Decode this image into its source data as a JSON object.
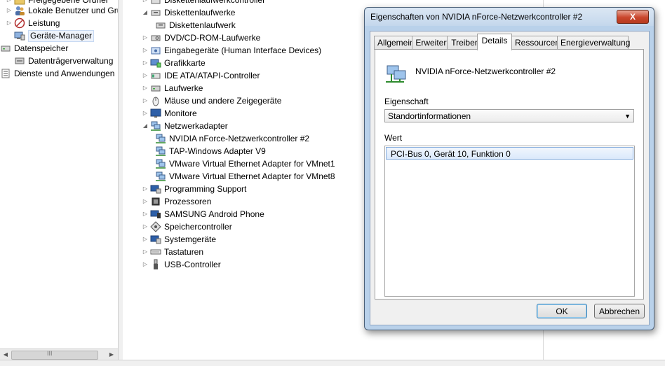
{
  "left_tree": {
    "items": [
      {
        "label": "Freigegebene Ordner",
        "icon": "shared-folder-icon",
        "arrow": "▷"
      },
      {
        "label": "Lokale Benutzer und Gruppen",
        "icon": "users-icon",
        "arrow": "▷"
      },
      {
        "label": "Leistung",
        "icon": "performance-icon",
        "arrow": "▷"
      },
      {
        "label": "Geräte-Manager",
        "icon": "device-manager-icon",
        "arrow": ""
      },
      {
        "label": "Datenspeicher",
        "icon": "storage-icon",
        "arrow": "◢"
      },
      {
        "label": "Datenträgerverwaltung",
        "icon": "disk-management-icon",
        "arrow": ""
      },
      {
        "label": "Dienste und Anwendungen",
        "icon": "services-icon",
        "arrow": "▷"
      }
    ]
  },
  "device_tree": {
    "items": [
      {
        "label": "Diskettenlaufwerkcontroller",
        "icon": "floppy-controller-icon",
        "arrow": "▷",
        "child": false
      },
      {
        "label": "Diskettenlaufwerke",
        "icon": "floppy-drive-icon",
        "arrow": "◢",
        "child": false
      },
      {
        "label": "Diskettenlaufwerk",
        "icon": "floppy-drive-icon",
        "arrow": "",
        "child": true
      },
      {
        "label": "DVD/CD-ROM-Laufwerke",
        "icon": "dvd-drive-icon",
        "arrow": "▷",
        "child": false
      },
      {
        "label": "Eingabegeräte (Human Interface Devices)",
        "icon": "hid-icon",
        "arrow": "▷",
        "child": false
      },
      {
        "label": "Grafikkarte",
        "icon": "display-adapter-icon",
        "arrow": "▷",
        "child": false
      },
      {
        "label": "IDE ATA/ATAPI-Controller",
        "icon": "ide-controller-icon",
        "arrow": "▷",
        "child": false
      },
      {
        "label": "Laufwerke",
        "icon": "disk-drive-icon",
        "arrow": "▷",
        "child": false
      },
      {
        "label": "Mäuse und andere Zeigegeräte",
        "icon": "mouse-icon",
        "arrow": "▷",
        "child": false
      },
      {
        "label": "Monitore",
        "icon": "monitor-icon",
        "arrow": "▷",
        "child": false
      },
      {
        "label": "Netzwerkadapter",
        "icon": "network-adapter-icon",
        "arrow": "◢",
        "child": false
      },
      {
        "label": "NVIDIA nForce-Netzwerkcontroller #2",
        "icon": "network-adapter-icon",
        "arrow": "",
        "child": true
      },
      {
        "label": "TAP-Windows Adapter V9",
        "icon": "network-adapter-icon",
        "arrow": "",
        "child": true
      },
      {
        "label": "VMware Virtual Ethernet Adapter for VMnet1",
        "icon": "network-adapter-icon",
        "arrow": "",
        "child": true
      },
      {
        "label": "VMware Virtual Ethernet Adapter for VMnet8",
        "icon": "network-adapter-icon",
        "arrow": "",
        "child": true
      },
      {
        "label": "Programming Support",
        "icon": "programming-support-icon",
        "arrow": "▷",
        "child": false
      },
      {
        "label": "Prozessoren",
        "icon": "processor-icon",
        "arrow": "▷",
        "child": false
      },
      {
        "label": "SAMSUNG Android Phone",
        "icon": "phone-icon",
        "arrow": "▷",
        "child": false
      },
      {
        "label": "Speichercontroller",
        "icon": "storage-controller-icon",
        "arrow": "▷",
        "child": false
      },
      {
        "label": "Systemgeräte",
        "icon": "system-devices-icon",
        "arrow": "▷",
        "child": false
      },
      {
        "label": "Tastaturen",
        "icon": "keyboard-icon",
        "arrow": "▷",
        "child": false
      },
      {
        "label": "USB-Controller",
        "icon": "usb-icon",
        "arrow": "▷",
        "child": false
      }
    ]
  },
  "dialog": {
    "title": "Eigenschaften von NVIDIA nForce-Netzwerkcontroller #2",
    "close_label": "X",
    "tabs": [
      {
        "label": "Allgemein",
        "active": false
      },
      {
        "label": "Erweitert",
        "active": false
      },
      {
        "label": "Treiber",
        "active": false
      },
      {
        "label": "Details",
        "active": true
      },
      {
        "label": "Ressourcen",
        "active": false
      },
      {
        "label": "Energieverwaltung",
        "active": false
      }
    ],
    "device_name": "NVIDIA nForce-Netzwerkcontroller #2",
    "property_label": "Eigenschaft",
    "property_value": "Standortinformationen",
    "value_label": "Wert",
    "values": [
      "PCI-Bus 0, Gerät 10, Funktion 0"
    ],
    "ok_label": "OK",
    "cancel_label": "Abbrechen"
  },
  "scrollbar": {
    "left_arrow": "◀",
    "right_arrow": "▶",
    "grip": "III"
  },
  "colors": {
    "accent": "#3c7fb1",
    "dialog_frame": "#b9d1ea",
    "selection": "#dbe9fb"
  }
}
